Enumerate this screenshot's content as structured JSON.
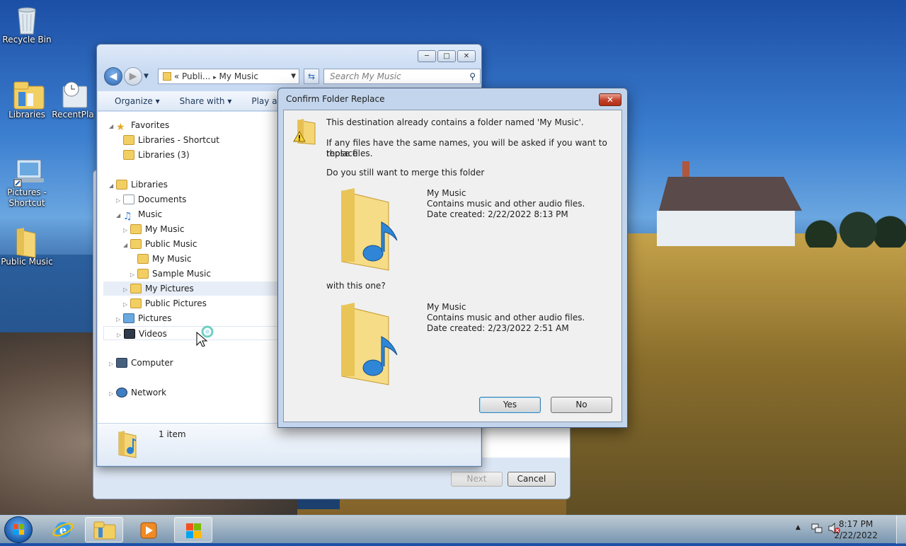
{
  "desktop": {
    "icons": [
      {
        "label": "Recycle Bin"
      },
      {
        "label": "Libraries"
      },
      {
        "label": "RecentPla"
      },
      {
        "label": "Pictures - Shortcut"
      },
      {
        "label": "Public Music"
      }
    ]
  },
  "explorer": {
    "title_buttons": {
      "minimize": "─",
      "maximize": "□",
      "close": "✕"
    },
    "address": {
      "prefix": "«",
      "crumb1": "Publi...",
      "sep": "▸",
      "crumb2": "My Music"
    },
    "search_placeholder": "Search My Music",
    "toolbar": {
      "organize": "Organize ▾",
      "share": "Share with ▾",
      "play": "Play all"
    },
    "tree": {
      "favorites": "Favorites",
      "libraries_shortcut": "Libraries - Shortcut",
      "libraries_3": "Libraries (3)",
      "libraries": "Libraries",
      "documents": "Documents",
      "music": "Music",
      "my_music": "My Music",
      "public_music": "Public Music",
      "my_music_sub": "My Music",
      "sample_music": "Sample Music",
      "my_pictures": "My Pictures",
      "public_pictures": "Public Pictures",
      "pictures": "Pictures",
      "videos": "Videos",
      "computer": "Computer",
      "network": "Network"
    },
    "status": "1 item"
  },
  "wizard": {
    "next": "Next",
    "cancel": "Cancel"
  },
  "dialog": {
    "title": "Confirm Folder Replace",
    "close": "✕",
    "line1": "This destination already contains a folder named 'My Music'.",
    "line2a": "If any files have the same names, you will be asked if you want to replace",
    "line2b": "those files.",
    "line3": "Do you still want to merge this folder",
    "folder1": {
      "name": "My Music",
      "desc": "Contains music and other audio files.",
      "date": "Date created: 2/22/2022 8:13 PM"
    },
    "with_text": "with this one?",
    "folder2": {
      "name": "My Music",
      "desc": "Contains music and other audio files.",
      "date": "Date created: 2/23/2022 2:51 AM"
    },
    "yes": "Yes",
    "no": "No"
  },
  "taskbar": {
    "time": "8:17 PM",
    "date": "2/22/2022"
  },
  "colors": {
    "accent": "#3c7fb1",
    "close_red": "#c2402a"
  }
}
